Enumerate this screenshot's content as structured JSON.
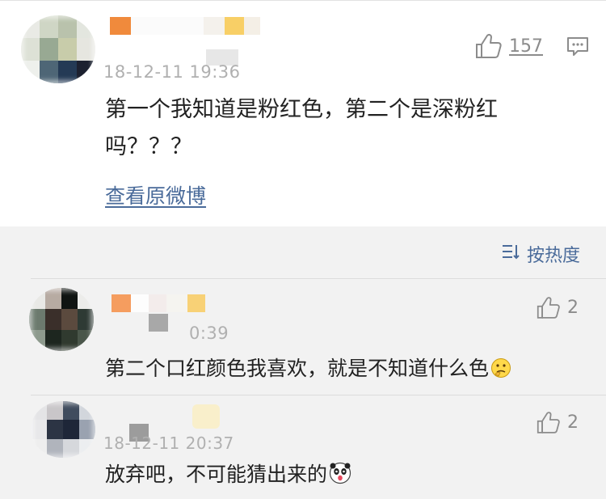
{
  "main_comment": {
    "timestamp": "18-12-11 19:36",
    "text_line1": "第一个我知道是粉红色，第二个是深粉红",
    "text_line2": "吗？？？",
    "likes": "157",
    "view_original_link": "查看原微博"
  },
  "sort": {
    "label": "按热度"
  },
  "replies": [
    {
      "timestamp": "0:39",
      "text": "第二个口红颜色我喜欢，就是不知道什么色",
      "emoji": "thinking-face-emoji",
      "likes": "2"
    },
    {
      "timestamp": "18-12-11 20:37",
      "text": "放弃吧，不可能猜出来的",
      "emoji": "scared-panda-emoji",
      "likes": "2"
    }
  ],
  "colors": {
    "link": "#4a6b9a",
    "background": "#f2f2f2",
    "card": "#ffffff"
  }
}
